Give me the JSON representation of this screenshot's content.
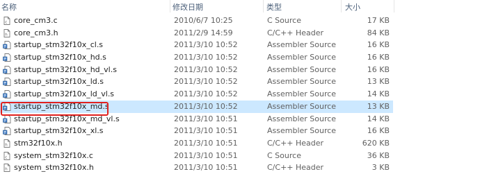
{
  "columns": {
    "name": "名称",
    "date": "修改日期",
    "type": "类型",
    "size": "大小"
  },
  "files": [
    {
      "name": "core_cm3.c",
      "date": "2010/6/7 10:25",
      "type": "C Source",
      "size": "17 KB",
      "icon": "c-source-file-icon",
      "selected": false
    },
    {
      "name": "core_cm3.h",
      "date": "2011/2/9 14:59",
      "type": "C/C++ Header",
      "size": "84 KB",
      "icon": "header-file-icon",
      "selected": false
    },
    {
      "name": "startup_stm32f10x_cl.s",
      "date": "2011/3/10 10:52",
      "type": "Assembler Source",
      "size": "16 KB",
      "icon": "assembler-file-icon",
      "selected": false
    },
    {
      "name": "startup_stm32f10x_hd.s",
      "date": "2011/3/10 10:52",
      "type": "Assembler Source",
      "size": "16 KB",
      "icon": "assembler-file-icon",
      "selected": false
    },
    {
      "name": "startup_stm32f10x_hd_vl.s",
      "date": "2011/3/10 10:52",
      "type": "Assembler Source",
      "size": "16 KB",
      "icon": "assembler-file-icon",
      "selected": false
    },
    {
      "name": "startup_stm32f10x_ld.s",
      "date": "2011/3/10 10:52",
      "type": "Assembler Source",
      "size": "13 KB",
      "icon": "assembler-file-icon",
      "selected": false
    },
    {
      "name": "startup_stm32f10x_ld_vl.s",
      "date": "2011/3/10 10:52",
      "type": "Assembler Source",
      "size": "14 KB",
      "icon": "assembler-file-icon",
      "selected": false
    },
    {
      "name": "startup_stm32f10x_md.s",
      "date": "2011/3/10 10:52",
      "type": "Assembler Source",
      "size": "13 KB",
      "icon": "assembler-file-icon",
      "selected": true
    },
    {
      "name": "startup_stm32f10x_md_vl.s",
      "date": "2011/3/10 10:51",
      "type": "Assembler Source",
      "size": "14 KB",
      "icon": "assembler-file-icon",
      "selected": false
    },
    {
      "name": "startup_stm32f10x_xl.s",
      "date": "2011/3/10 10:51",
      "type": "Assembler Source",
      "size": "16 KB",
      "icon": "assembler-file-icon",
      "selected": false
    },
    {
      "name": "stm32f10x.h",
      "date": "2011/3/10 10:51",
      "type": "C/C++ Header",
      "size": "620 KB",
      "icon": "header-file-icon",
      "selected": false
    },
    {
      "name": "system_stm32f10x.c",
      "date": "2011/3/10 10:51",
      "type": "C Source",
      "size": "36 KB",
      "icon": "c-source-file-icon",
      "selected": false
    },
    {
      "name": "system_stm32f10x.h",
      "date": "2011/3/10 10:51",
      "type": "C/C++ Header",
      "size": "3 KB",
      "icon": "header-file-icon",
      "selected": false
    }
  ],
  "colors": {
    "selection": "#cce8ff",
    "highlight_border": "#e0201d",
    "header_text": "#4c607a"
  }
}
